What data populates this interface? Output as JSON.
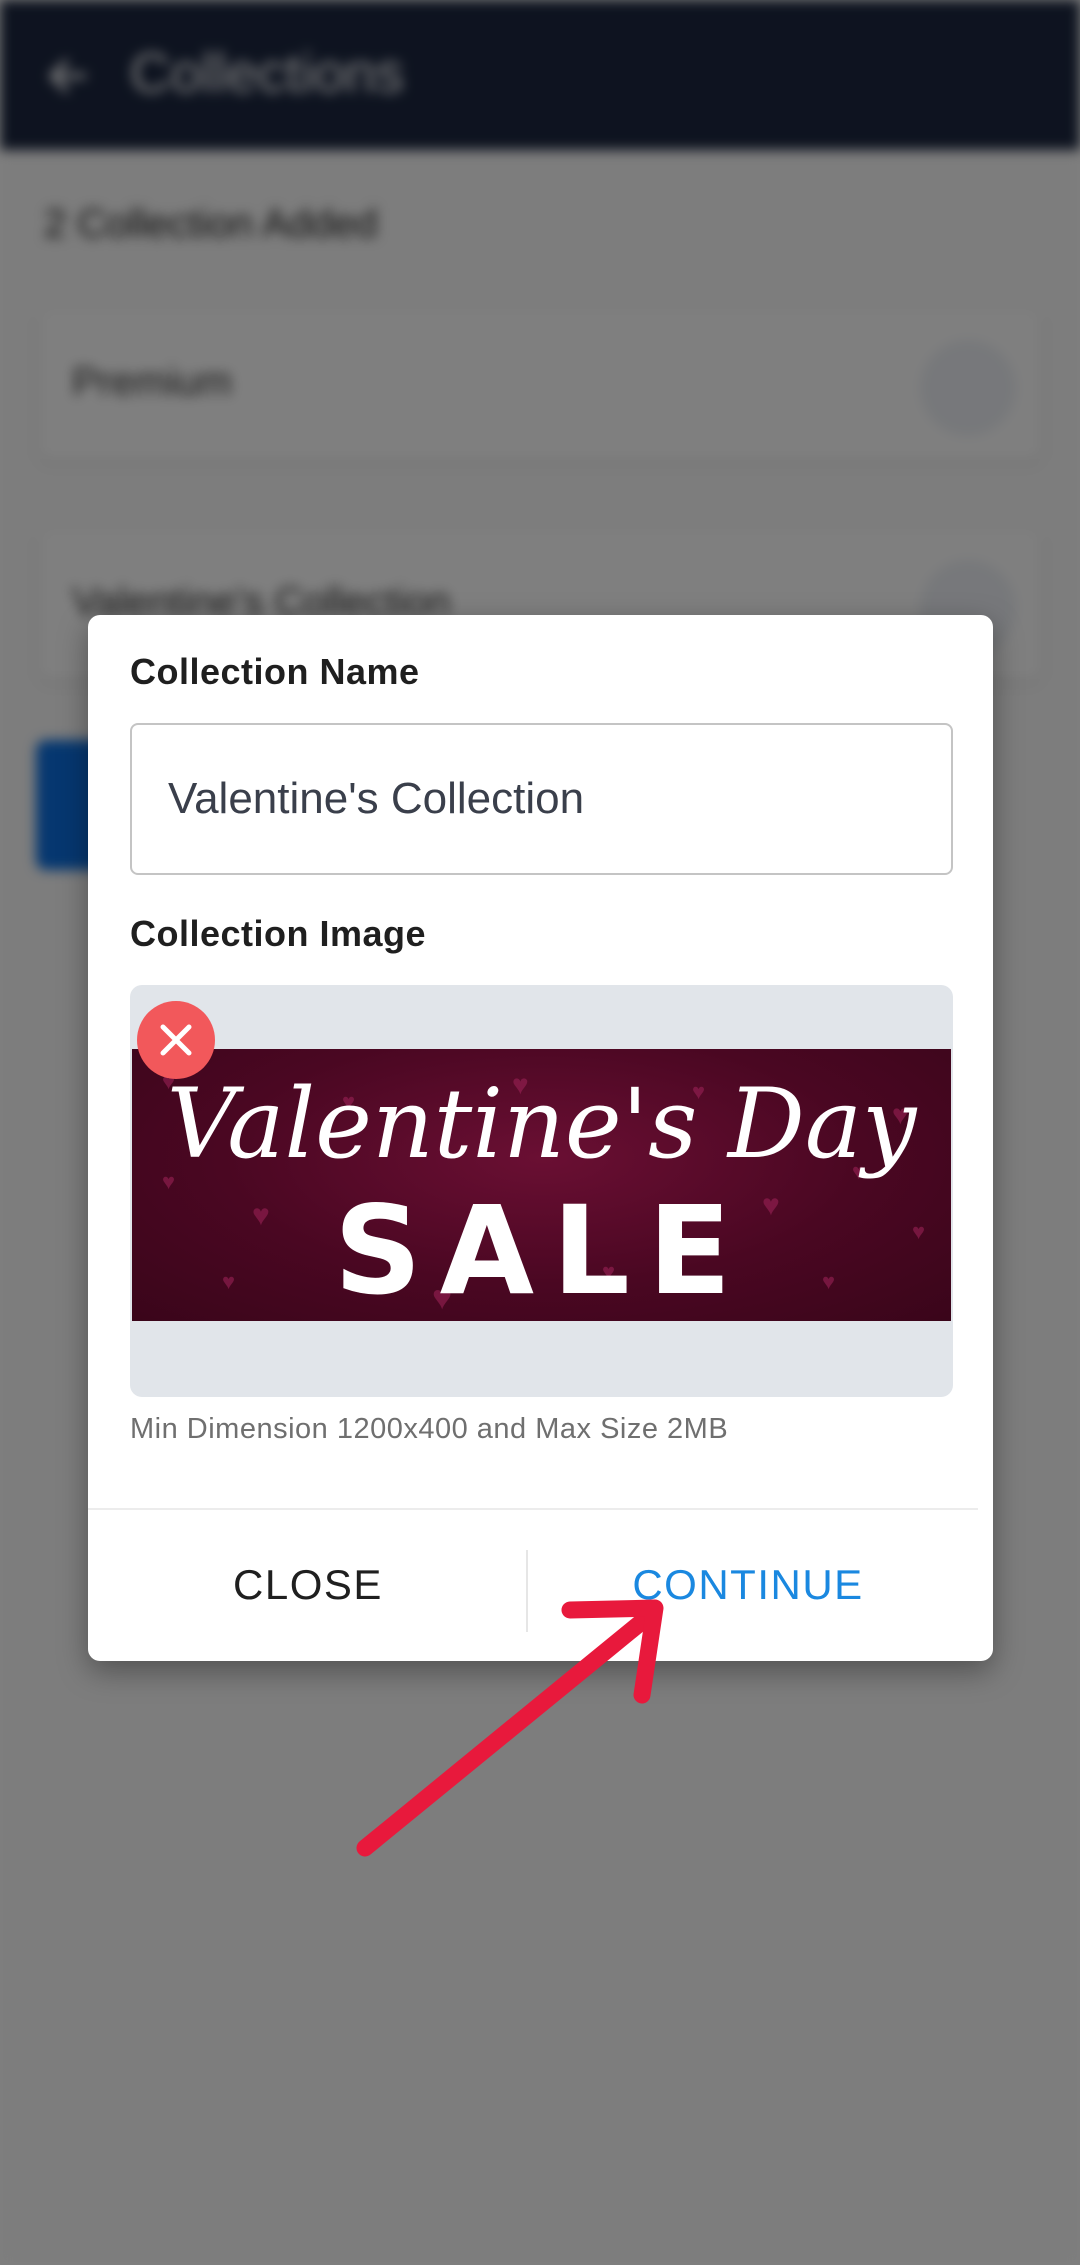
{
  "background": {
    "header_title": "Collections",
    "count_text": "2 Collection Added",
    "cards": [
      {
        "label": "Premium"
      },
      {
        "label": "Valentine's Collection"
      }
    ]
  },
  "dialog": {
    "name_label": "Collection Name",
    "name_value": "Valentine's Collection",
    "image_label": "Collection Image",
    "image_text": {
      "script": "Valentine's Day",
      "headline": "SALE"
    },
    "hint": "Min Dimension 1200x400 and Max Size 2MB",
    "close_label": "CLOSE",
    "continue_label": "CONTINUE"
  },
  "colors": {
    "header": "#1c2740",
    "accent": "#1a88e0",
    "remove": "#f2585b",
    "annotation_arrow": "#e8193c"
  },
  "icons": [
    "back-arrow-icon",
    "close-x-icon",
    "annotation-arrow-icon"
  ]
}
